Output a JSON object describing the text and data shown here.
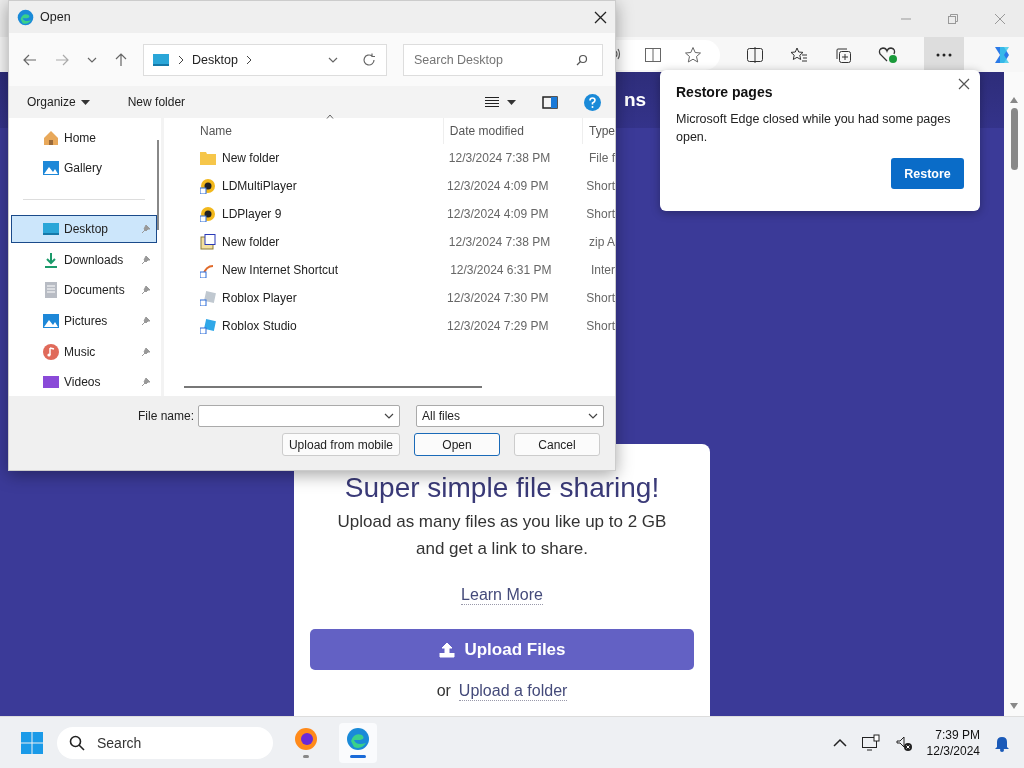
{
  "dialog": {
    "title": "Open",
    "address": {
      "location": "Desktop"
    },
    "search": {
      "placeholder": "Search Desktop"
    },
    "commands": {
      "organize": "Organize",
      "new_folder": "New folder"
    },
    "sidebar": {
      "top": [
        {
          "label": "Home",
          "kind": "home",
          "selected": false,
          "pinned": false
        },
        {
          "label": "Gallery",
          "kind": "gallery",
          "selected": false,
          "pinned": false
        }
      ],
      "places": [
        {
          "label": "Desktop",
          "kind": "desktop",
          "selected": true,
          "pinned": true
        },
        {
          "label": "Downloads",
          "kind": "downloads",
          "selected": false,
          "pinned": true
        },
        {
          "label": "Documents",
          "kind": "documents",
          "selected": false,
          "pinned": true
        },
        {
          "label": "Pictures",
          "kind": "pictures",
          "selected": false,
          "pinned": true
        },
        {
          "label": "Music",
          "kind": "music",
          "selected": false,
          "pinned": true
        },
        {
          "label": "Videos",
          "kind": "videos",
          "selected": false,
          "pinned": true
        }
      ]
    },
    "columns": [
      "Name",
      "Date modified",
      "Type"
    ],
    "rows": [
      {
        "name": "New folder",
        "date": "12/3/2024 7:38 PM",
        "type": "File f",
        "kind": "folder"
      },
      {
        "name": "LDMultiPlayer",
        "date": "12/3/2024 4:09 PM",
        "type": "Short",
        "kind": "app"
      },
      {
        "name": "LDPlayer 9",
        "date": "12/3/2024 4:09 PM",
        "type": "Short",
        "kind": "app"
      },
      {
        "name": "New folder",
        "date": "12/3/2024 7:38 PM",
        "type": "zip A",
        "kind": "zip"
      },
      {
        "name": "New Internet Shortcut",
        "date": "12/3/2024 6:31 PM",
        "type": "Inter",
        "kind": "link"
      },
      {
        "name": "Roblox Player",
        "date": "12/3/2024 7:30 PM",
        "type": "Short",
        "kind": "roblox"
      },
      {
        "name": "Roblox Studio",
        "date": "12/3/2024 7:29 PM",
        "type": "Short",
        "kind": "studio"
      }
    ],
    "file_name_label": "File name:",
    "file_type": "All files",
    "buttons": [
      {
        "label": "Upload from mobile",
        "default": false
      },
      {
        "label": "Open",
        "default": true
      },
      {
        "label": "Cancel",
        "default": false
      }
    ]
  },
  "browser": {
    "header_fragment": "ns",
    "popup": {
      "title": "Restore pages",
      "message": "Microsoft Edge closed while you had some pages open.",
      "button": "Restore"
    },
    "card": {
      "heading": "Super simple file sharing!",
      "description": "Upload as many files as you like up to 2 GB and get a link to share.",
      "learn_more": "Learn More",
      "upload_button": "Upload Files",
      "or": "or",
      "folder_link": "Upload a folder"
    }
  },
  "taskbar": {
    "search": {
      "placeholder": "Search"
    },
    "apps": [
      {
        "kind": "firefox",
        "selected": false
      },
      {
        "kind": "edge",
        "selected": true
      }
    ],
    "time": "7:39 PM",
    "date": "12/3/2024"
  }
}
